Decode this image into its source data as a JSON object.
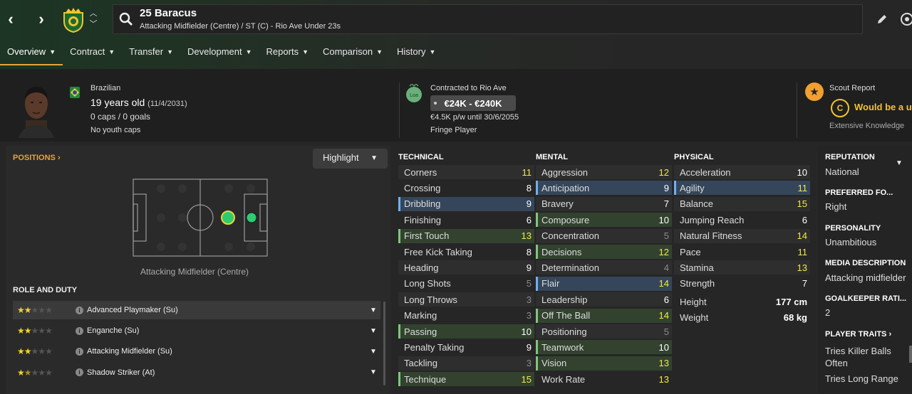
{
  "header": {
    "title": "25 Baracus",
    "subtitle": "Attacking Midfielder (Centre) / ST (C) - Rio Ave Under 23s"
  },
  "tabs": [
    {
      "label": "Overview"
    },
    {
      "label": "Contract"
    },
    {
      "label": "Transfer"
    },
    {
      "label": "Development"
    },
    {
      "label": "Reports"
    },
    {
      "label": "Comparison"
    },
    {
      "label": "History"
    }
  ],
  "bio": {
    "nationality": "Brazilian",
    "age": "19 years old",
    "dob": "(11/4/2031)",
    "caps": "0 caps / 0 goals",
    "youth_caps": "No youth caps"
  },
  "contract": {
    "club_badge": "Loa",
    "contracted": "Contracted to Rio Ave",
    "value": "€24K - €240K",
    "wage": "€4.5K p/w until 30/6/2055",
    "status": "Fringe Player"
  },
  "scout": {
    "title": "Scout Report",
    "verdict": "Would be a us",
    "knowledge": "Extensive Knowledge",
    "coin": "C"
  },
  "positions": {
    "link": "POSITIONS",
    "highlight": "Highlight",
    "label": "Attacking Midfielder (Centre)"
  },
  "roles": {
    "title": "ROLE AND DUTY",
    "items": [
      {
        "label": "Advanced Playmaker (Su)",
        "stars": 2,
        "half": false
      },
      {
        "label": "Enganche (Su)",
        "stars": 2,
        "half": false
      },
      {
        "label": "Attacking Midfielder (Su)",
        "stars": 2,
        "half": false
      },
      {
        "label": "Shadow Striker (At)",
        "stars": 1,
        "half": true
      }
    ]
  },
  "technical": {
    "title": "TECHNICAL",
    "items": [
      {
        "label": "Corners",
        "value": "11"
      },
      {
        "label": "Crossing",
        "value": "8"
      },
      {
        "label": "Dribbling",
        "value": "9"
      },
      {
        "label": "Finishing",
        "value": "6"
      },
      {
        "label": "First Touch",
        "value": "13"
      },
      {
        "label": "Free Kick Taking",
        "value": "8"
      },
      {
        "label": "Heading",
        "value": "9"
      },
      {
        "label": "Long Shots",
        "value": "5"
      },
      {
        "label": "Long Throws",
        "value": "3"
      },
      {
        "label": "Marking",
        "value": "3"
      },
      {
        "label": "Passing",
        "value": "10"
      },
      {
        "label": "Penalty Taking",
        "value": "9"
      },
      {
        "label": "Tackling",
        "value": "3"
      },
      {
        "label": "Technique",
        "value": "15"
      }
    ]
  },
  "mental": {
    "title": "MENTAL",
    "items": [
      {
        "label": "Aggression",
        "value": "12"
      },
      {
        "label": "Anticipation",
        "value": "9"
      },
      {
        "label": "Bravery",
        "value": "7"
      },
      {
        "label": "Composure",
        "value": "10"
      },
      {
        "label": "Concentration",
        "value": "5"
      },
      {
        "label": "Decisions",
        "value": "12"
      },
      {
        "label": "Determination",
        "value": "4"
      },
      {
        "label": "Flair",
        "value": "14"
      },
      {
        "label": "Leadership",
        "value": "6"
      },
      {
        "label": "Off The Ball",
        "value": "14"
      },
      {
        "label": "Positioning",
        "value": "5"
      },
      {
        "label": "Teamwork",
        "value": "10"
      },
      {
        "label": "Vision",
        "value": "13"
      },
      {
        "label": "Work Rate",
        "value": "13"
      }
    ]
  },
  "physical": {
    "title": "PHYSICAL",
    "items": [
      {
        "label": "Acceleration",
        "value": "10"
      },
      {
        "label": "Agility",
        "value": "11"
      },
      {
        "label": "Balance",
        "value": "15"
      },
      {
        "label": "Jumping Reach",
        "value": "6"
      },
      {
        "label": "Natural Fitness",
        "value": "14"
      },
      {
        "label": "Pace",
        "value": "11"
      },
      {
        "label": "Stamina",
        "value": "13"
      },
      {
        "label": "Strength",
        "value": "7"
      }
    ],
    "height_label": "Height",
    "height": "177 cm",
    "weight_label": "Weight",
    "weight": "68 kg"
  },
  "side": {
    "reputation_head": "REPUTATION",
    "reputation": "National",
    "foot_head": "PREFERRED FO...",
    "foot": "Right",
    "personality_head": "PERSONALITY",
    "personality": "Unambitious",
    "media_head": "MEDIA DESCRIPTION",
    "media": "Attacking midfielder",
    "gk_head": "GOALKEEPER RATI...",
    "gk": "2",
    "traits_head": "PLAYER TRAITS",
    "trait1a": "Tries Killer Balls",
    "trait1b": "Often",
    "trait2": "Tries Long Range"
  },
  "colors": {
    "accent": "#e8a43a",
    "high": "#f2e84a",
    "highlight_blue": "#6fb0f0",
    "highlight_green": "#7fc77a"
  }
}
